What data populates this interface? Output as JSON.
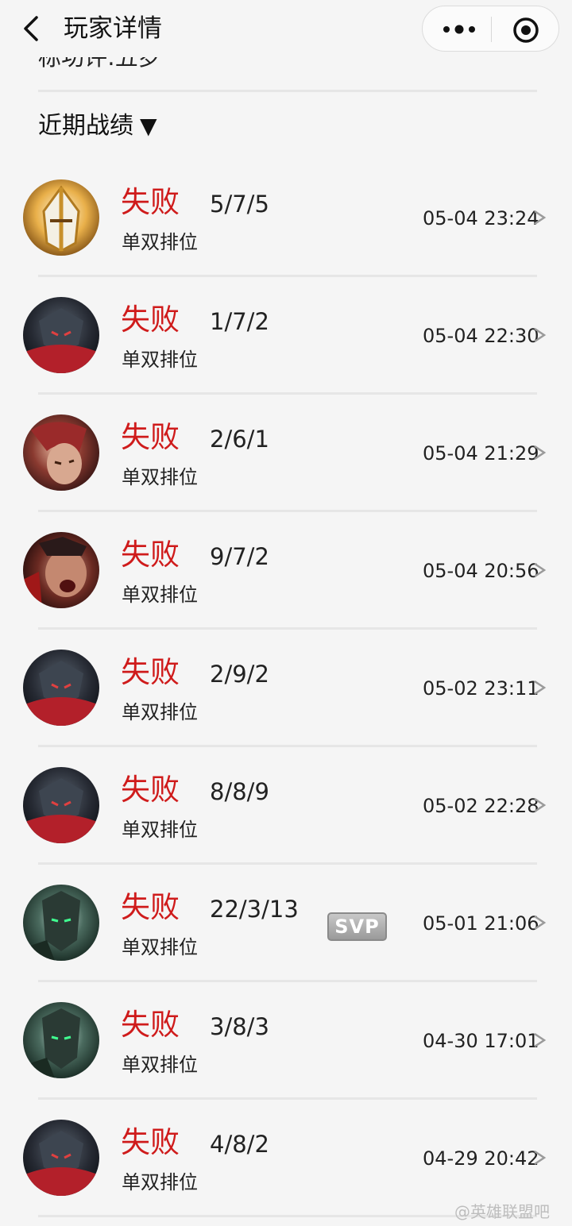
{
  "header": {
    "title": "玩家详情"
  },
  "prev_section": {
    "label": "标功评:五罗"
  },
  "section": {
    "title": "近期战绩",
    "toggle_glyph": "▼"
  },
  "matches": [
    {
      "champion_icon": "champion-golden-helm-icon",
      "result": "失败",
      "kda": "5/7/5",
      "mode": "单双排位",
      "time": "05-04 23:24",
      "badge": ""
    },
    {
      "champion_icon": "champion-dark-knight-icon",
      "result": "失败",
      "kda": "1/7/2",
      "mode": "单双排位",
      "time": "05-04 22:30",
      "badge": ""
    },
    {
      "champion_icon": "champion-red-hair-icon",
      "result": "失败",
      "kda": "2/6/1",
      "mode": "单双排位",
      "time": "05-04 21:29",
      "badge": ""
    },
    {
      "champion_icon": "champion-warrior-shout-icon",
      "result": "失败",
      "kda": "9/7/2",
      "mode": "单双排位",
      "time": "05-04 20:56",
      "badge": ""
    },
    {
      "champion_icon": "champion-dark-knight-icon",
      "result": "失败",
      "kda": "2/9/2",
      "mode": "单双排位",
      "time": "05-02 23:11",
      "badge": ""
    },
    {
      "champion_icon": "champion-dark-knight-icon",
      "result": "失败",
      "kda": "8/8/9",
      "mode": "单双排位",
      "time": "05-02 22:28",
      "badge": ""
    },
    {
      "champion_icon": "champion-green-armor-icon",
      "result": "失败",
      "kda": "22/3/13",
      "mode": "单双排位",
      "time": "05-01 21:06",
      "badge": "SVP"
    },
    {
      "champion_icon": "champion-green-armor-icon",
      "result": "失败",
      "kda": "3/8/3",
      "mode": "单双排位",
      "time": "04-30 17:01",
      "badge": ""
    },
    {
      "champion_icon": "champion-dark-knight-icon",
      "result": "失败",
      "kda": "4/8/2",
      "mode": "单双排位",
      "time": "04-29 20:42",
      "badge": ""
    }
  ],
  "colors": {
    "loss": "#cf1b1b",
    "background": "#f5f5f5",
    "divider": "#e6e6e6"
  },
  "watermark": "@英雄联盟吧"
}
